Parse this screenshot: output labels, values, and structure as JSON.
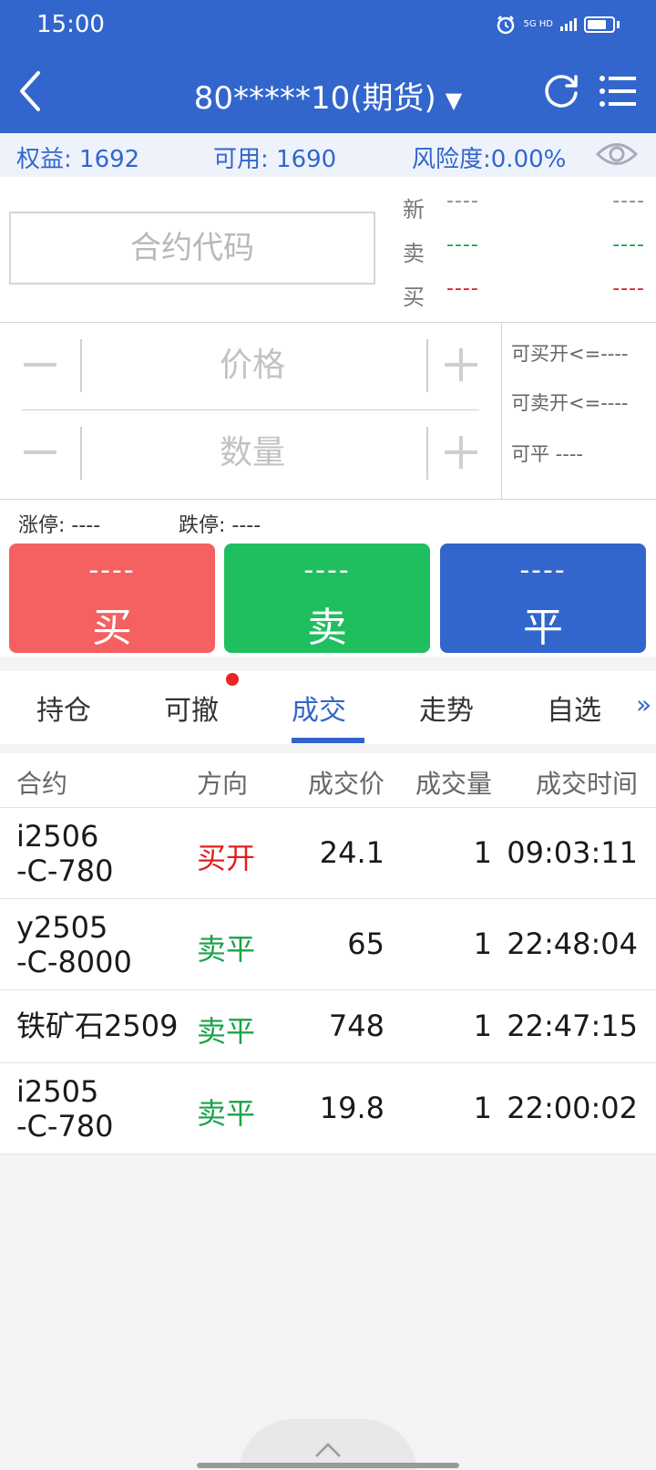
{
  "status_bar": {
    "time": "15:00",
    "network_label": "5G HD"
  },
  "header": {
    "account_title": "80*****10(期货)"
  },
  "info_bar": {
    "equity": "权益: 1692",
    "available": "可用: 1690",
    "risk": "风险度:0.00%"
  },
  "contract": {
    "placeholder": "合约代码",
    "quotes": [
      {
        "label": "新",
        "left": "----",
        "right": "----",
        "color": "gray"
      },
      {
        "label": "卖",
        "left": "----",
        "right": "----",
        "color": "green"
      },
      {
        "label": "买",
        "left": "----",
        "right": "----",
        "color": "red"
      }
    ]
  },
  "order": {
    "price_placeholder": "价格",
    "qty_placeholder": "数量",
    "can_buy_open": "可买开<=----",
    "can_sell_open": "可卖开<=----",
    "can_close": "可平  ----"
  },
  "limits": {
    "limit_up": "涨停: ----",
    "limit_down": "跌停: ----"
  },
  "actions": {
    "buy": {
      "price": "----",
      "label": "买"
    },
    "sell": {
      "price": "----",
      "label": "卖"
    },
    "close": {
      "price": "----",
      "label": "平"
    }
  },
  "tabs": [
    {
      "label": "持仓"
    },
    {
      "label": "可撤"
    },
    {
      "label": "成交"
    },
    {
      "label": "走势"
    },
    {
      "label": "自选"
    }
  ],
  "active_tab": "成交",
  "more_icon": "»",
  "trades": {
    "headers": {
      "contract": "合约",
      "direction": "方向",
      "price": "成交价",
      "volume": "成交量",
      "time": "成交时间"
    },
    "rows": [
      {
        "contract": "i2506\n-C-780",
        "direction": "买开",
        "dir_color": "#e41e1e",
        "price": "24.1",
        "volume": "1",
        "time": "09:03:11"
      },
      {
        "contract": "y2505\n-C-8000",
        "direction": "卖平",
        "dir_color": "#1aa34a",
        "price": "65",
        "volume": "1",
        "time": "22:48:04"
      },
      {
        "contract": "铁矿石2509",
        "direction": "卖平",
        "dir_color": "#1aa34a",
        "price": "748",
        "volume": "1",
        "time": "22:47:15"
      },
      {
        "contract": "i2505\n-C-780",
        "direction": "卖平",
        "dir_color": "#1aa34a",
        "price": "19.8",
        "volume": "1",
        "time": "22:00:02"
      }
    ]
  }
}
